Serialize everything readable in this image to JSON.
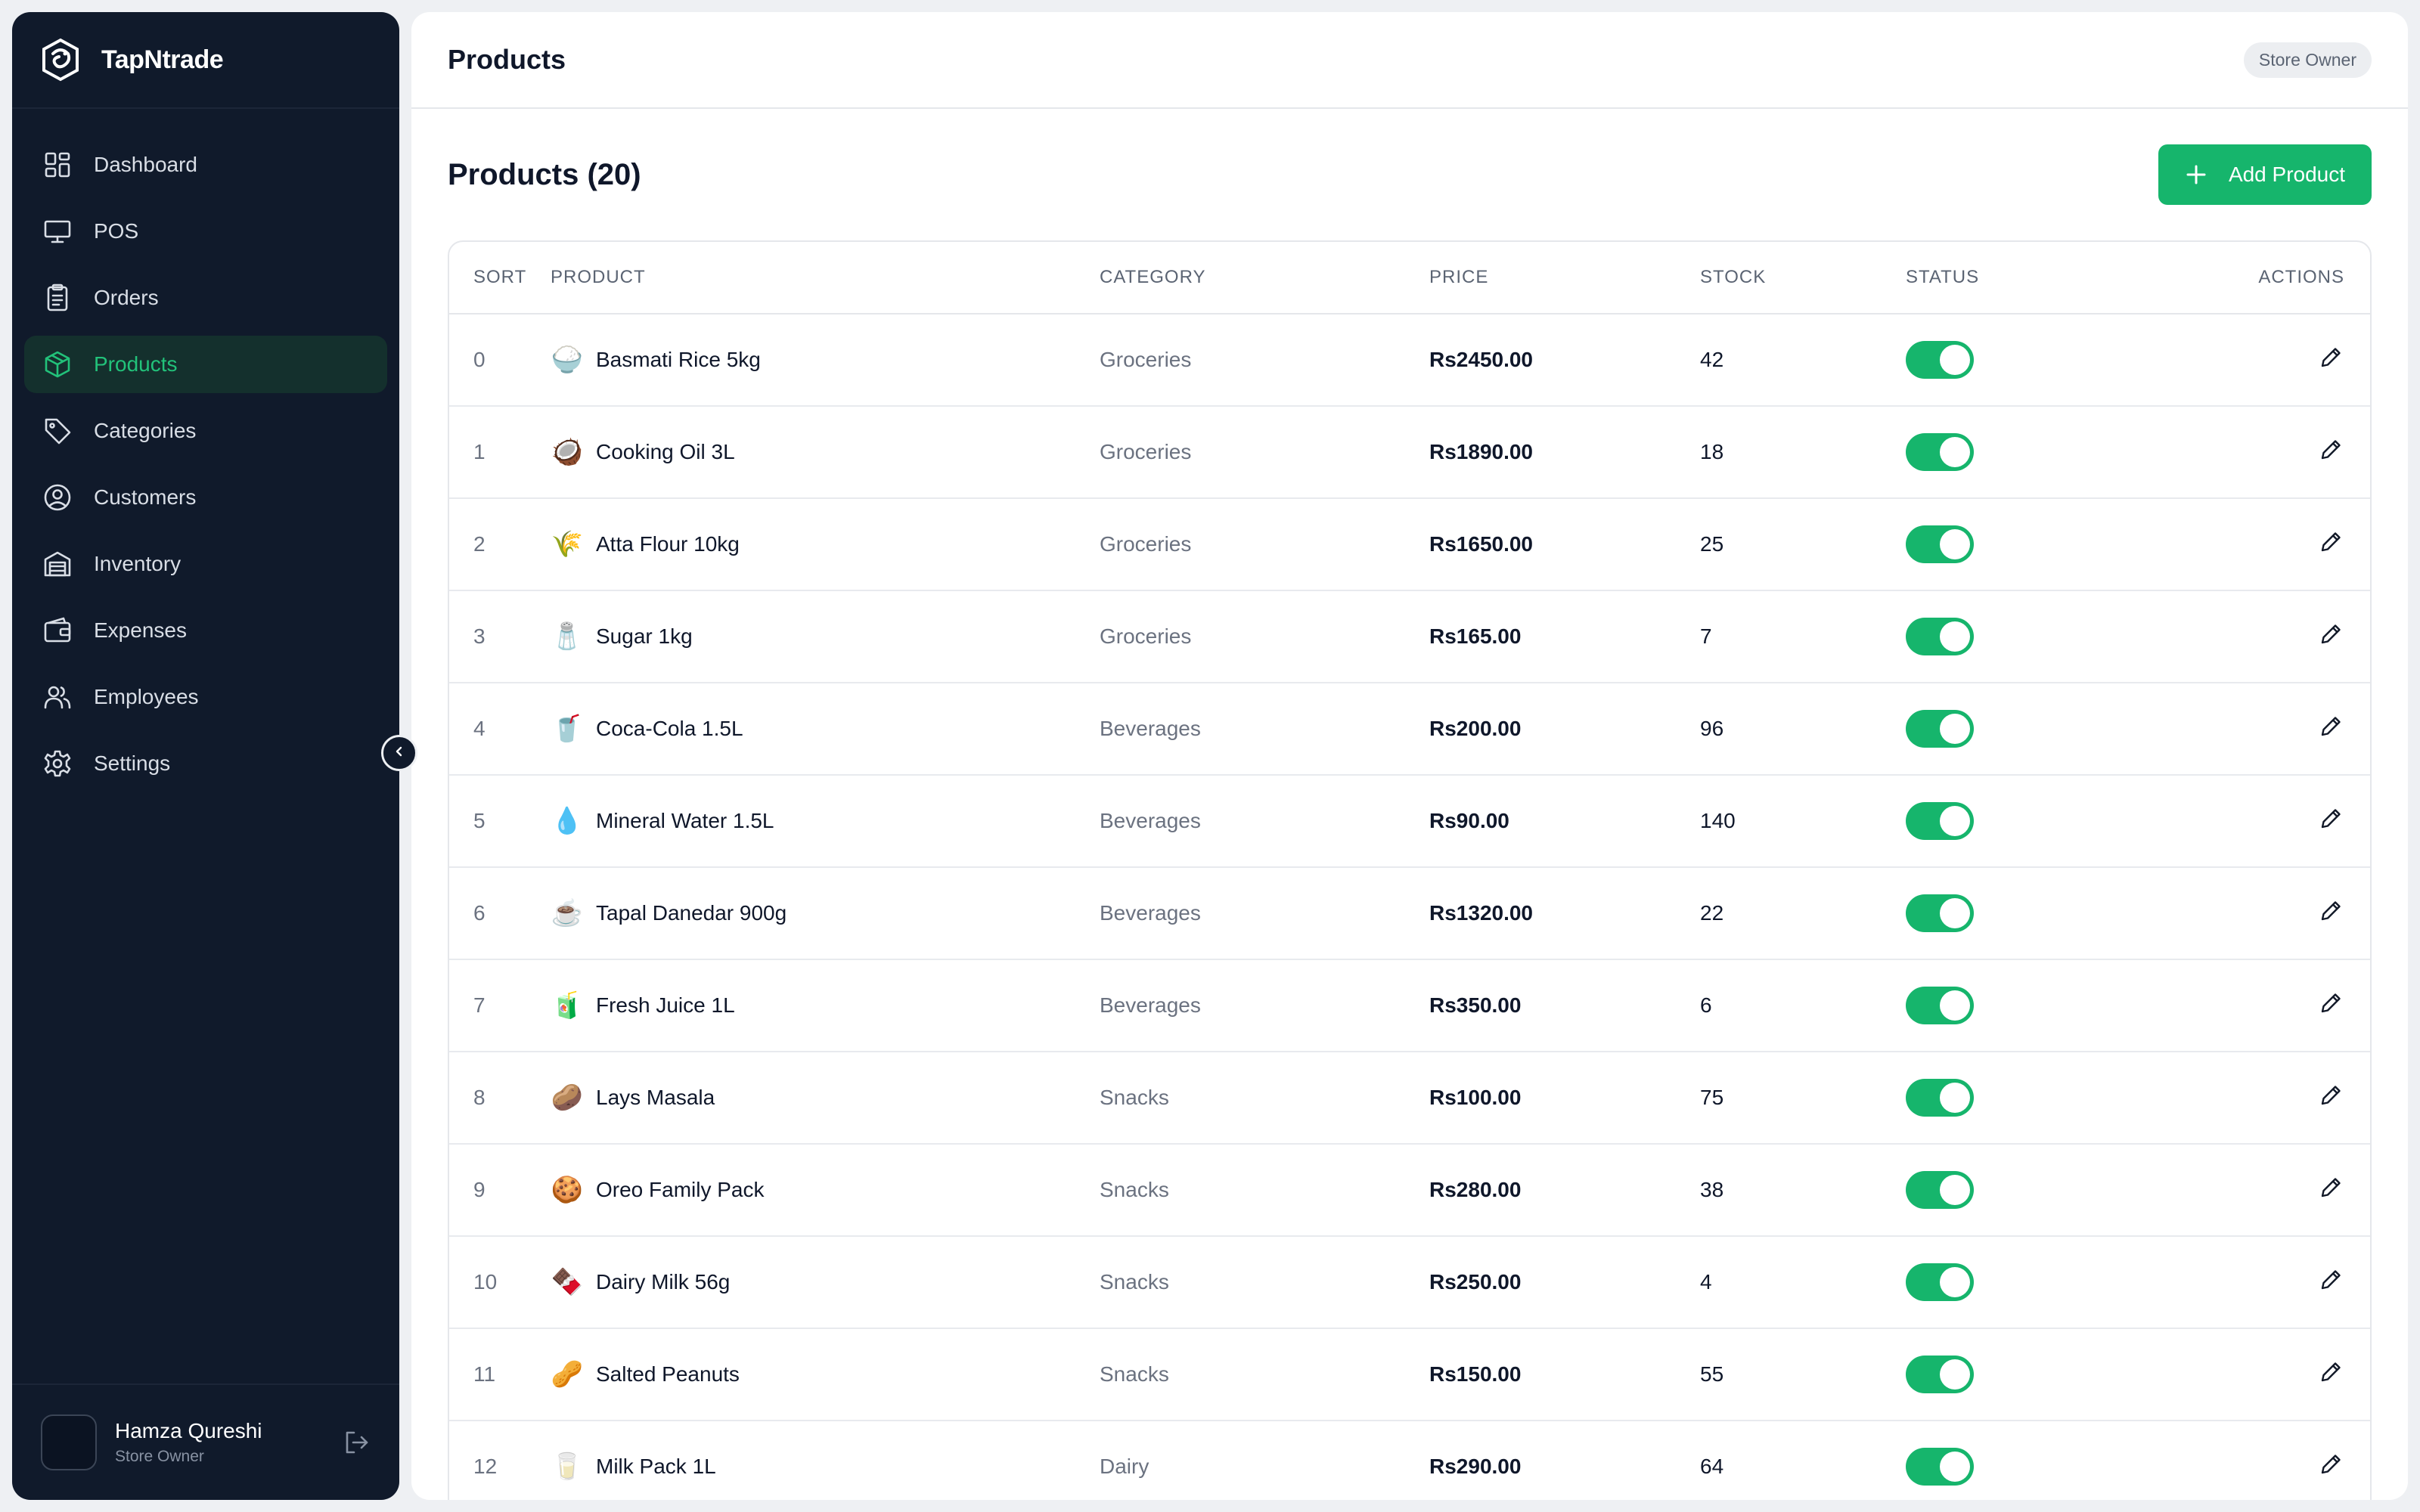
{
  "brand": {
    "name": "TapNtrade",
    "logo_icon": "dragon-logo-icon"
  },
  "sidebar": {
    "items": [
      {
        "label": "Dashboard",
        "icon": "dashboard-grid-icon"
      },
      {
        "label": "POS",
        "icon": "monitor-icon"
      },
      {
        "label": "Orders",
        "icon": "clipboard-icon"
      },
      {
        "label": "Products",
        "icon": "box-icon",
        "active": true
      },
      {
        "label": "Categories",
        "icon": "tag-icon"
      },
      {
        "label": "Customers",
        "icon": "user-circle-icon"
      },
      {
        "label": "Inventory",
        "icon": "warehouse-icon"
      },
      {
        "label": "Expenses",
        "icon": "wallet-icon"
      },
      {
        "label": "Employees",
        "icon": "users-icon"
      },
      {
        "label": "Settings",
        "icon": "gear-icon"
      }
    ]
  },
  "user": {
    "name": "Hamza Qureshi",
    "role": "Store Owner"
  },
  "header": {
    "title": "Products",
    "role_badge": "Store Owner"
  },
  "content": {
    "title": "Products (20)",
    "add_button": "Add Product"
  },
  "table": {
    "columns": {
      "sort": "SORT",
      "product": "PRODUCT",
      "category": "CATEGORY",
      "price": "PRICE",
      "stock": "STOCK",
      "status": "STATUS",
      "actions": "ACTIONS"
    },
    "rows": [
      {
        "sort": "0",
        "emoji": "🍚",
        "name": "Basmati Rice 5kg",
        "category": "Groceries",
        "price": "Rs2450.00",
        "stock": "42",
        "active": true
      },
      {
        "sort": "1",
        "emoji": "🥥",
        "name": "Cooking Oil 3L",
        "category": "Groceries",
        "price": "Rs1890.00",
        "stock": "18",
        "active": true
      },
      {
        "sort": "2",
        "emoji": "🌾",
        "name": "Atta Flour 10kg",
        "category": "Groceries",
        "price": "Rs1650.00",
        "stock": "25",
        "active": true
      },
      {
        "sort": "3",
        "emoji": "🧂",
        "name": "Sugar 1kg",
        "category": "Groceries",
        "price": "Rs165.00",
        "stock": "7",
        "active": true
      },
      {
        "sort": "4",
        "emoji": "🥤",
        "name": "Coca-Cola 1.5L",
        "category": "Beverages",
        "price": "Rs200.00",
        "stock": "96",
        "active": true
      },
      {
        "sort": "5",
        "emoji": "💧",
        "name": "Mineral Water 1.5L",
        "category": "Beverages",
        "price": "Rs90.00",
        "stock": "140",
        "active": true
      },
      {
        "sort": "6",
        "emoji": "☕",
        "name": "Tapal Danedar 900g",
        "category": "Beverages",
        "price": "Rs1320.00",
        "stock": "22",
        "active": true
      },
      {
        "sort": "7",
        "emoji": "🧃",
        "name": "Fresh Juice 1L",
        "category": "Beverages",
        "price": "Rs350.00",
        "stock": "6",
        "active": true
      },
      {
        "sort": "8",
        "emoji": "🥔",
        "name": "Lays Masala",
        "category": "Snacks",
        "price": "Rs100.00",
        "stock": "75",
        "active": true
      },
      {
        "sort": "9",
        "emoji": "🍪",
        "name": "Oreo Family Pack",
        "category": "Snacks",
        "price": "Rs280.00",
        "stock": "38",
        "active": true
      },
      {
        "sort": "10",
        "emoji": "🍫",
        "name": "Dairy Milk 56g",
        "category": "Snacks",
        "price": "Rs250.00",
        "stock": "4",
        "active": true
      },
      {
        "sort": "11",
        "emoji": "🥜",
        "name": "Salted Peanuts",
        "category": "Snacks",
        "price": "Rs150.00",
        "stock": "55",
        "active": true
      },
      {
        "sort": "12",
        "emoji": "🥛",
        "name": "Milk Pack 1L",
        "category": "Dairy",
        "price": "Rs290.00",
        "stock": "64",
        "active": true
      }
    ]
  },
  "colors": {
    "sidebar_bg": "#101a2b",
    "accent": "#16b56c",
    "active_text": "#22c27a",
    "active_bg": "#14302d"
  }
}
